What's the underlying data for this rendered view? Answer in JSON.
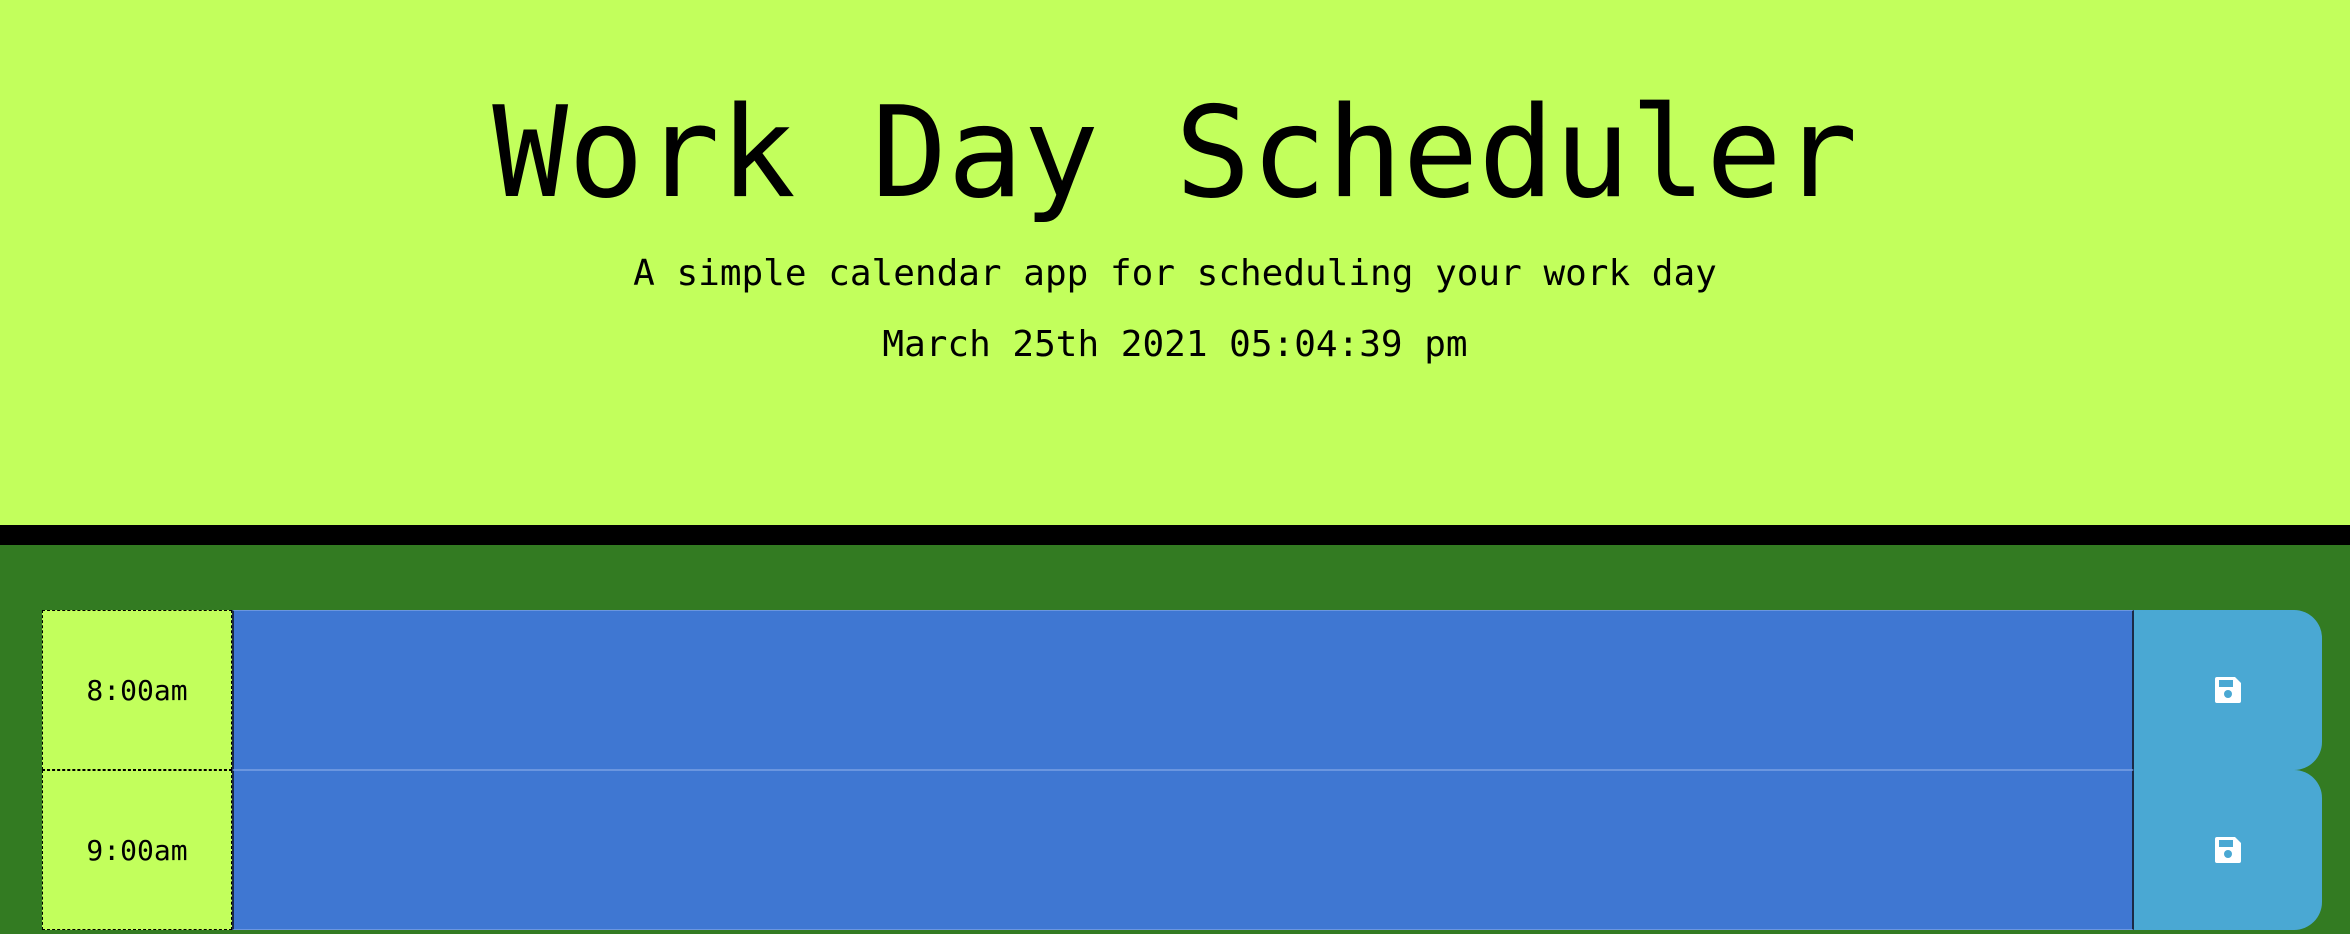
{
  "header": {
    "title": "Work Day Scheduler",
    "subtitle": "A simple calendar app for scheduling your work day",
    "datetime": "March 25th 2021 05:04:39 pm"
  },
  "time_blocks": [
    {
      "hour": "8:00am",
      "task": "",
      "status": "future",
      "save_icon": "floppy-disk-icon"
    },
    {
      "hour": "9:00am",
      "task": "",
      "status": "future",
      "save_icon": "floppy-disk-icon"
    }
  ],
  "colors": {
    "header_bg": "#c2ff5c",
    "content_bg": "#337b22",
    "future_block": "#3f77d2",
    "save_button": "#4aa8d3",
    "hour_bg": "#c2ff5c"
  }
}
